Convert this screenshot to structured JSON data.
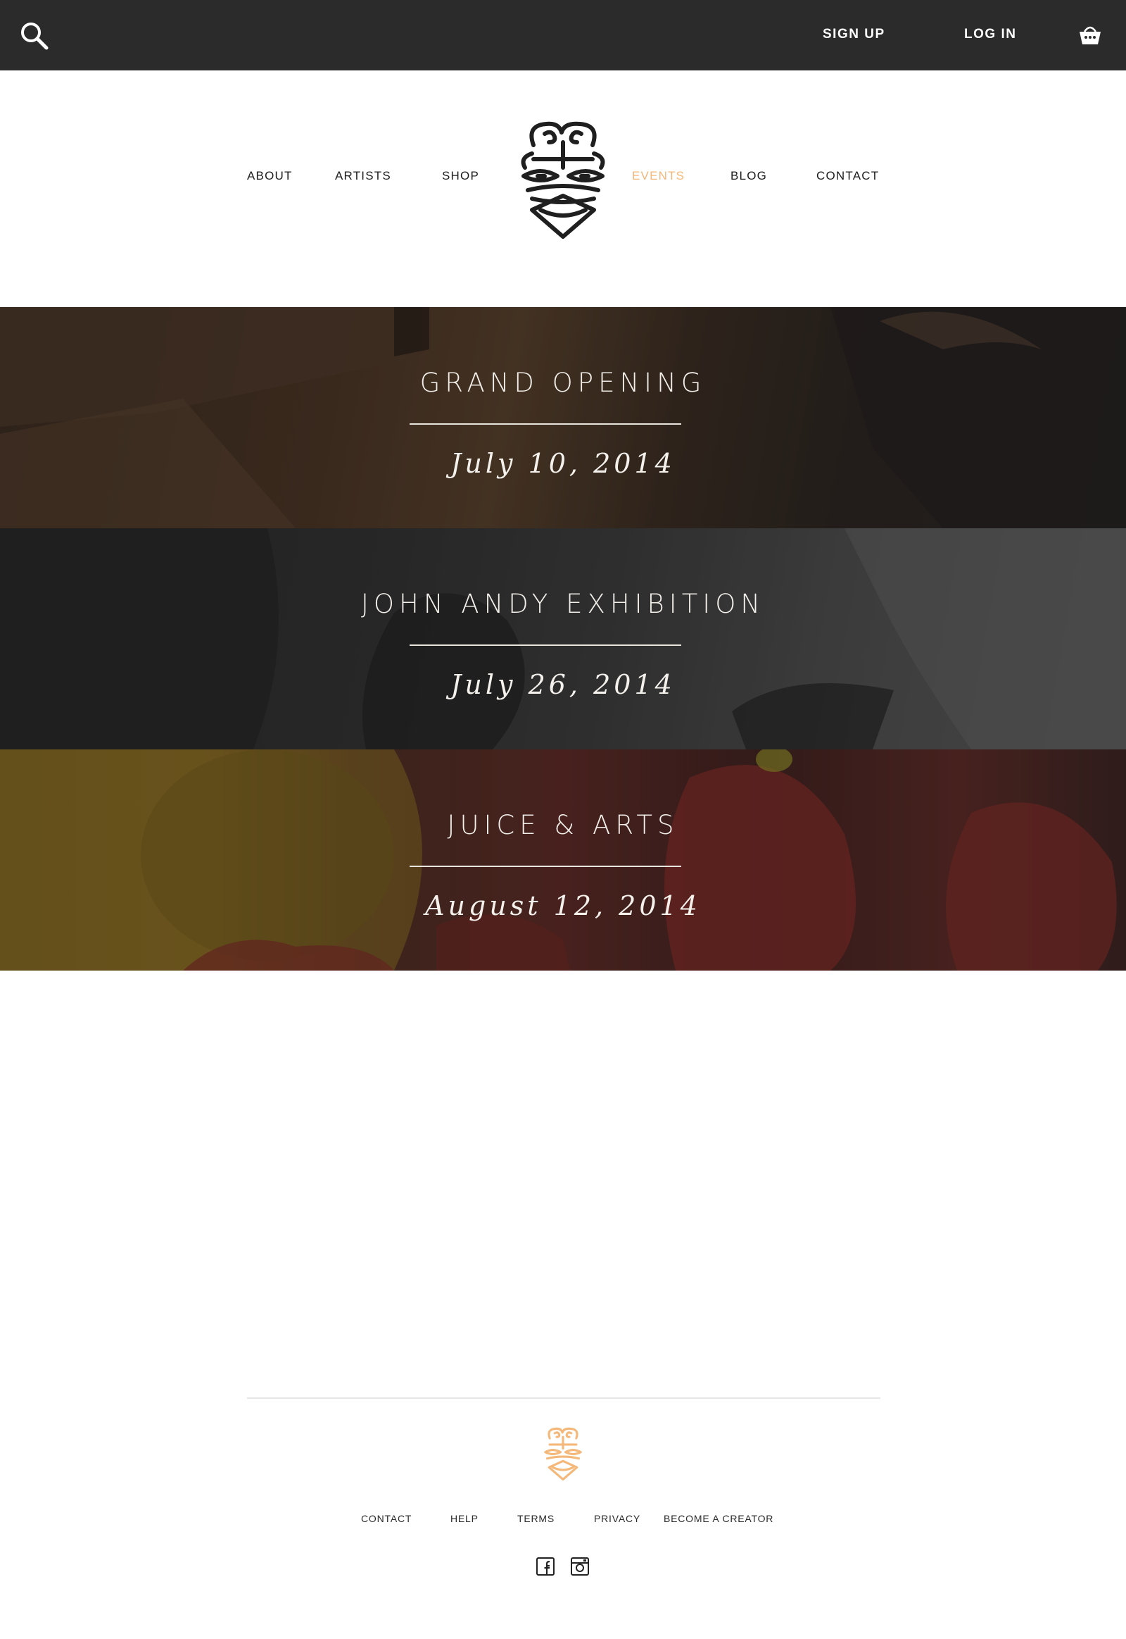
{
  "topbar": {
    "search_icon": "search-icon",
    "sign_up": "SIGN UP",
    "log_in": "LOG IN",
    "cart_icon": "basket-icon"
  },
  "nav": {
    "items": [
      {
        "label": "ABOUT",
        "active": false
      },
      {
        "label": "ARTISTS",
        "active": false
      },
      {
        "label": "SHOP",
        "active": false
      },
      {
        "label": "EVENTS",
        "active": true
      },
      {
        "label": "BLOG",
        "active": false
      },
      {
        "label": "CONTACT",
        "active": false
      }
    ],
    "active_color": "#f3b87a",
    "logo_icon": "mask-logo-icon"
  },
  "events": [
    {
      "title": "GRAND OPENING",
      "date": "July 10, 2014"
    },
    {
      "title": "JOHN ANDY EXHIBITION",
      "date": "July 26, 2014"
    },
    {
      "title": "JUICE & ARTS",
      "date": "August 12, 2014"
    }
  ],
  "footer": {
    "logo_color": "#f3b87a",
    "links": [
      "CONTACT",
      "HELP",
      "TERMS",
      "PRIVACY",
      "BECOME A CREATOR"
    ],
    "social": [
      "facebook-icon",
      "instagram-icon"
    ]
  },
  "colors": {
    "topbar_bg": "#2b2b2b",
    "accent": "#f3b87a"
  }
}
